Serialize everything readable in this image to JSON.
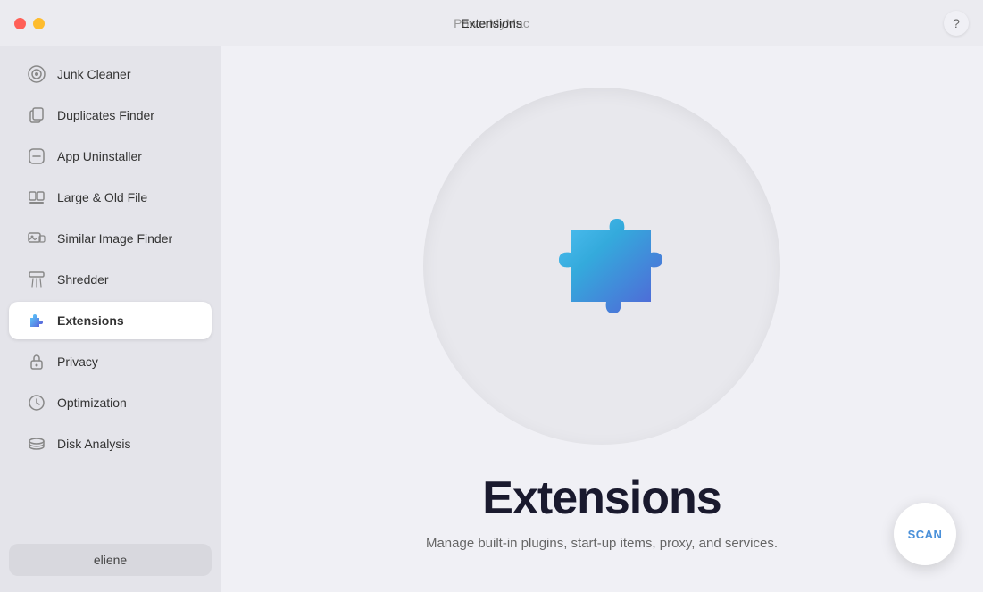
{
  "titleBar": {
    "appName": "PowerMyMac",
    "headerTitle": "Extensions",
    "helpLabel": "?"
  },
  "sidebar": {
    "items": [
      {
        "id": "junk-cleaner",
        "label": "Junk Cleaner",
        "active": false
      },
      {
        "id": "duplicates-finder",
        "label": "Duplicates Finder",
        "active": false
      },
      {
        "id": "app-uninstaller",
        "label": "App Uninstaller",
        "active": false
      },
      {
        "id": "large-old-file",
        "label": "Large & Old File",
        "active": false
      },
      {
        "id": "similar-image-finder",
        "label": "Similar Image Finder",
        "active": false
      },
      {
        "id": "shredder",
        "label": "Shredder",
        "active": false
      },
      {
        "id": "extensions",
        "label": "Extensions",
        "active": true
      },
      {
        "id": "privacy",
        "label": "Privacy",
        "active": false
      },
      {
        "id": "optimization",
        "label": "Optimization",
        "active": false
      },
      {
        "id": "disk-analysis",
        "label": "Disk Analysis",
        "active": false
      }
    ],
    "userLabel": "eliene"
  },
  "content": {
    "title": "Extensions",
    "subtitle": "Manage built-in plugins, start-up items, proxy, and services.",
    "scanLabel": "SCAN"
  }
}
